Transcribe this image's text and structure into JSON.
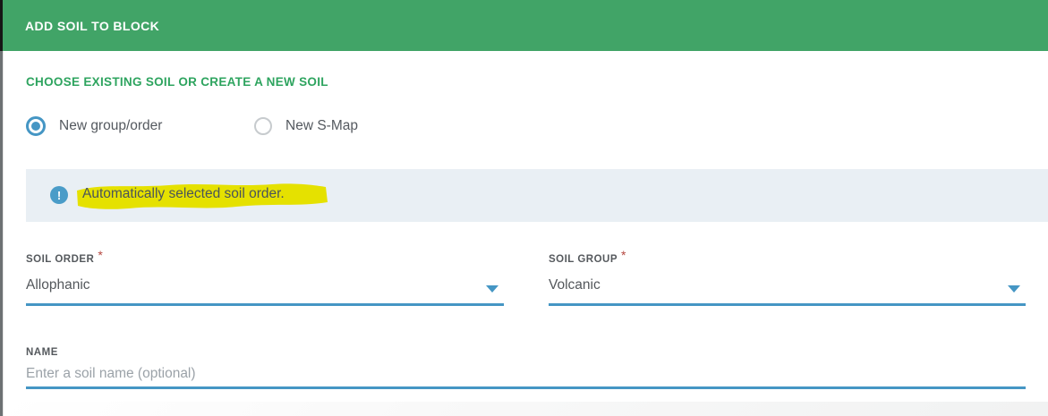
{
  "header": {
    "title": "ADD SOIL TO BLOCK"
  },
  "section": {
    "heading": "CHOOSE EXISTING SOIL OR CREATE A NEW SOIL"
  },
  "radios": [
    {
      "label": "New group/order",
      "selected": true
    },
    {
      "label": "New S-Map",
      "selected": false
    }
  ],
  "banner": {
    "icon_glyph": "!",
    "message": "Automatically selected soil order.",
    "highlighted": true
  },
  "fields": {
    "soil_order": {
      "label": "SOIL ORDER",
      "required_marker": "*",
      "value": "Allophanic"
    },
    "soil_group": {
      "label": "SOIL GROUP",
      "required_marker": "*",
      "value": "Volcanic"
    },
    "name": {
      "label": "NAME",
      "placeholder": "Enter a soil name (optional)",
      "value": ""
    }
  },
  "colors": {
    "header_green": "#41a467",
    "heading_green": "#2ea45f",
    "accent_blue": "#4596c4",
    "info_icon_blue": "#4a9cc8",
    "banner_bg": "#e9eff4",
    "highlight_yellow": "#e5e100",
    "required_red": "#b5473f",
    "text_dark": "#53575b",
    "label_gray": "#55595d",
    "placeholder_gray": "#9ba2a8"
  }
}
